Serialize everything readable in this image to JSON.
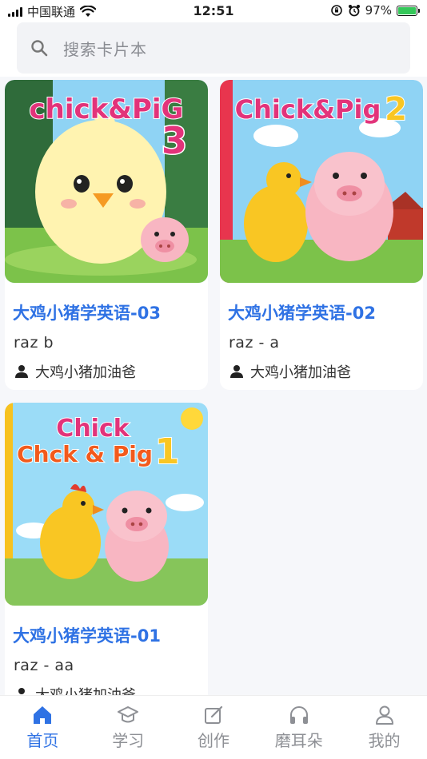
{
  "status_bar": {
    "carrier": "中国联通",
    "time": "12:51",
    "battery": "97%"
  },
  "search": {
    "placeholder": "搜索卡片本"
  },
  "cards": [
    {
      "title": "大鸡小猪学英语-03",
      "subtitle": "raz b",
      "author": "大鸡小猪加油爸",
      "cover_text": "chick&PiG",
      "cover_number": "3"
    },
    {
      "title": "大鸡小猪学英语-02",
      "subtitle": "raz - a",
      "author": "大鸡小猪加油爸",
      "cover_text": "Chick&Pig",
      "cover_number": "2"
    },
    {
      "title": "大鸡小猪学英语-01",
      "subtitle": "raz - aa",
      "author": "大鸡小猪加油爸",
      "cover_text_line1": "Chick",
      "cover_text_line2": "Chck & Pig",
      "cover_number": "1"
    }
  ],
  "tabs": [
    {
      "label": "首页",
      "icon": "home-icon",
      "active": true
    },
    {
      "label": "学习",
      "icon": "graduation-cap-icon",
      "active": false
    },
    {
      "label": "创作",
      "icon": "edit-icon",
      "active": false
    },
    {
      "label": "磨耳朵",
      "icon": "headphones-icon",
      "active": false
    },
    {
      "label": "我的",
      "icon": "user-icon",
      "active": false
    }
  ],
  "colors": {
    "accent": "#2f72e4",
    "tab_inactive": "#8e9095",
    "battery_green": "#34c759"
  }
}
